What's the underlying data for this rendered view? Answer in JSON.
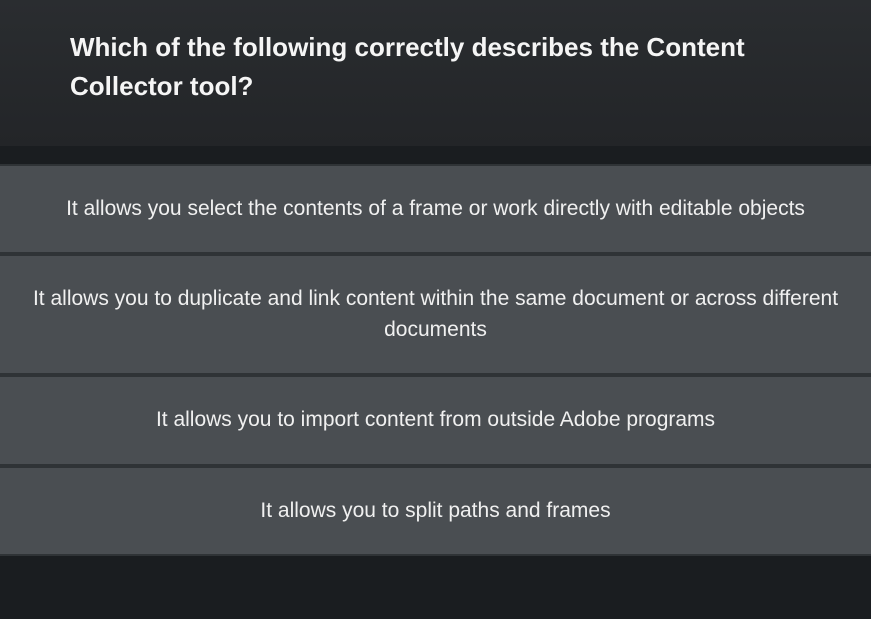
{
  "question": {
    "text": "Which of the following correctly describes the Content Collector tool?"
  },
  "answers": [
    {
      "text": "It allows you select the contents of a frame or work directly with editable objects"
    },
    {
      "text": "It allows you to duplicate and link content within the same document or across different documents"
    },
    {
      "text": "It allows you to import content from outside Adobe programs"
    },
    {
      "text": "It allows you to split paths and frames"
    }
  ]
}
